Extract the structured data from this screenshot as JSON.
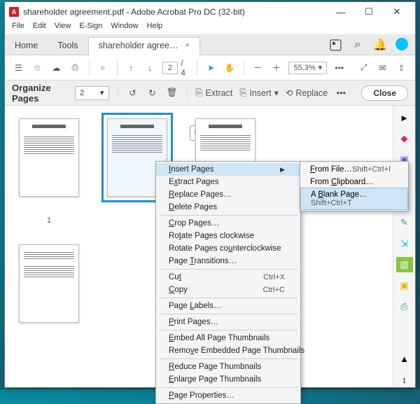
{
  "window": {
    "title": "shareholder agreement.pdf - Adobe Acrobat Pro DC (32-bit)",
    "app_glyph": "A"
  },
  "menubar": {
    "items": [
      "File",
      "Edit",
      "View",
      "E-Sign",
      "Window",
      "Help"
    ]
  },
  "tabs": {
    "home": "Home",
    "tools": "Tools",
    "doc": "shareholder agree…",
    "close_x": "×"
  },
  "toolbar": {
    "page_current": "2",
    "page_total": "/  4",
    "zoom": "55.3%",
    "zoom_arrow": "▾",
    "dots": "•••"
  },
  "orgbar": {
    "title": "Organize Pages",
    "page_selector": "2",
    "selector_arrow": "▾",
    "extract": "Extract",
    "insert": "Insert",
    "replace": "Replace",
    "dots": "•••",
    "close": "Close",
    "ins_arrow": "▾"
  },
  "thumbs": {
    "p1_label": "1"
  },
  "context_menu": {
    "items": [
      {
        "label": "Insert Pages",
        "sub": true,
        "sel": true
      },
      {
        "label": "Extract Pages"
      },
      {
        "label": "Replace Pages…"
      },
      {
        "label": "Delete Pages"
      },
      {
        "sep": true
      },
      {
        "label": "Crop Pages…"
      },
      {
        "label": "Rotate Pages clockwise"
      },
      {
        "label": "Rotate Pages counterclockwise"
      },
      {
        "label": "Page Transitions…"
      },
      {
        "sep": true
      },
      {
        "label": "Cut",
        "shortcut": "Ctrl+X"
      },
      {
        "label": "Copy",
        "shortcut": "Ctrl+C"
      },
      {
        "sep": true
      },
      {
        "label": "Page Labels…"
      },
      {
        "sep": true
      },
      {
        "label": "Print Pages…"
      },
      {
        "sep": true
      },
      {
        "label": "Embed All Page Thumbnails"
      },
      {
        "label": "Remove Embedded Page Thumbnails"
      },
      {
        "sep": true
      },
      {
        "label": "Reduce Page Thumbnails"
      },
      {
        "label": "Enlarge Page Thumbnails"
      },
      {
        "sep": true
      },
      {
        "label": "Page Properties…"
      }
    ]
  },
  "submenu": {
    "items": [
      {
        "label": "From File…",
        "shortcut": "Shift+Ctrl+I"
      },
      {
        "label": "From Clipboard…"
      },
      {
        "label": "A Blank Page…",
        "shortcut": "Shift+Ctrl+T",
        "hl": true
      }
    ]
  },
  "glyphs": {
    "min": "—",
    "max": "☐",
    "close": "✕",
    "menu": "☰",
    "star": "☆",
    "cloud": "☁",
    "print": "⎙",
    "search": "⌕",
    "up": "↑",
    "down": "↓",
    "pointer": "➤",
    "hand": "✋",
    "zminus": "－",
    "zplus": "＋",
    "fit": "⤢",
    "mail": "✉",
    "share": "⇪",
    "pen": "✎",
    "bell": "🔔",
    "rotl": "↺",
    "rotr": "↻",
    "trash": "🗑",
    "extract": "⎘",
    "insert": "⎘",
    "replace": "⟲",
    "tri_left": "◄",
    "tri_right": "►",
    "mountain": "▲",
    "arrows": "↕"
  }
}
